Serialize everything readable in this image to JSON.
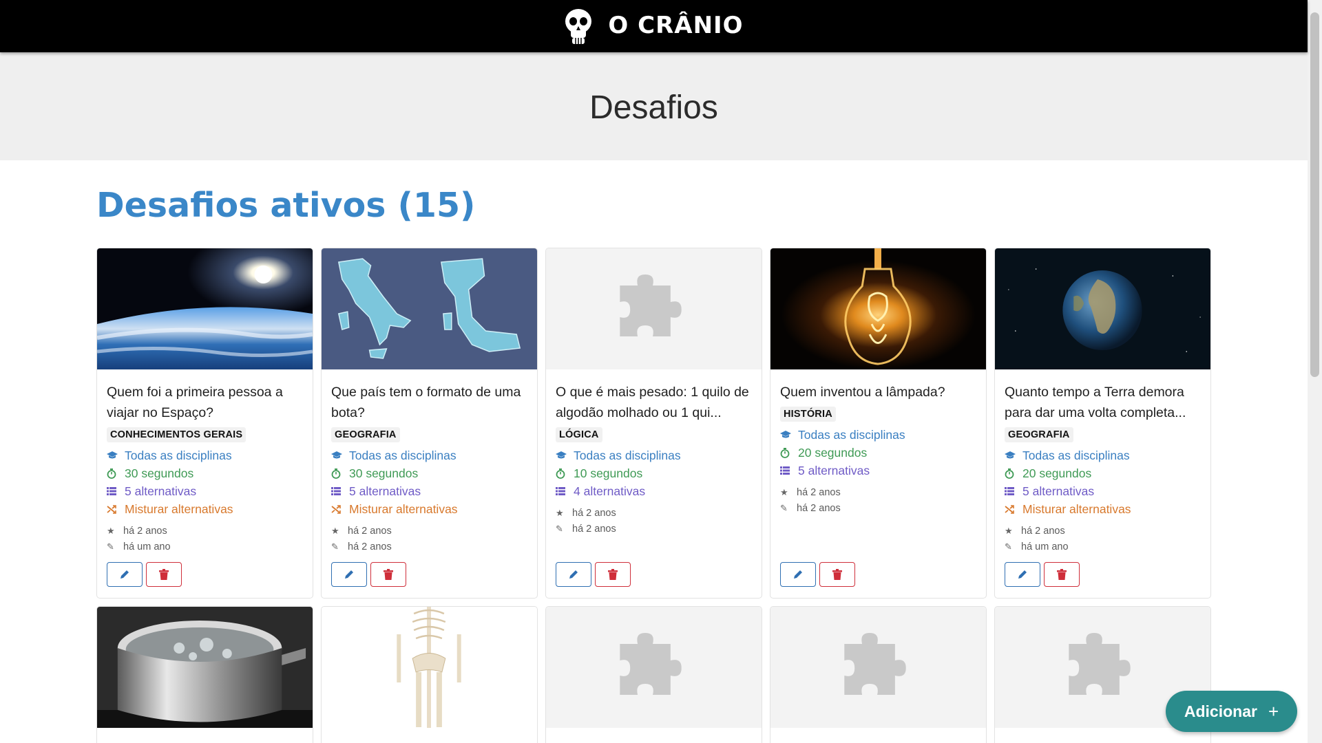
{
  "header": {
    "brand_name": "O CRÂNIO",
    "logo_icon": "skull-icon"
  },
  "hero": {
    "title": "Desafios"
  },
  "section": {
    "title": "Desafios ativos (15)"
  },
  "cards": [
    {
      "title": "Quem foi a primeira pessoa a viajar no Espaço?",
      "tag": "CONHECIMENTOS GERAIS",
      "image": "earth-orbit-sun",
      "discipline": "Todas as disciplinas",
      "time": "30 segundos",
      "alternatives": "5 alternativas",
      "shuffle": "Misturar alternativas",
      "created": "há 2 anos",
      "edited": "há um ano"
    },
    {
      "title": "Que país tem o formato de uma bota?",
      "tag": "GEOGRAFIA",
      "image": "italy-boot",
      "discipline": "Todas as disciplinas",
      "time": "30 segundos",
      "alternatives": "5 alternativas",
      "shuffle": "Misturar alternativas",
      "created": "há 2 anos",
      "edited": "há 2 anos"
    },
    {
      "title": "O que é mais pesado: 1 quilo de algodão molhado ou 1 qui...",
      "tag": "LÓGICA",
      "image": "puzzle-placeholder",
      "discipline": "Todas as disciplinas",
      "time": "10 segundos",
      "alternatives": "4 alternativas",
      "shuffle": "",
      "created": "há 2 anos",
      "edited": "há 2 anos"
    },
    {
      "title": "Quem inventou a lâmpada?",
      "tag": "HISTÓRIA",
      "image": "light-bulb",
      "discipline": "Todas as disciplinas",
      "time": "20 segundos",
      "alternatives": "5 alternativas",
      "shuffle": "",
      "created": "há 2 anos",
      "edited": "há 2 anos"
    },
    {
      "title": "Quanto tempo a Terra demora para dar uma volta completa...",
      "tag": "GEOGRAFIA",
      "image": "earth-globe",
      "discipline": "Todas as disciplinas",
      "time": "20 segundos",
      "alternatives": "5 alternativas",
      "shuffle": "Misturar alternativas",
      "created": "há 2 anos",
      "edited": "há um ano"
    },
    {
      "image": "boiling-pot"
    },
    {
      "image": "skeleton"
    },
    {
      "image": "puzzle-placeholder"
    },
    {
      "image": "puzzle-placeholder"
    },
    {
      "image": "puzzle-placeholder"
    }
  ],
  "fab": {
    "label": "Adicionar",
    "plus": "+"
  },
  "colors": {
    "brand_bg": "#000000",
    "accent_blue": "#3a87c8",
    "green": "#3f9a55",
    "purple": "#6f5bc6",
    "orange": "#d8792d",
    "danger": "#cf2e3a",
    "fab": "#2a8c8c"
  }
}
